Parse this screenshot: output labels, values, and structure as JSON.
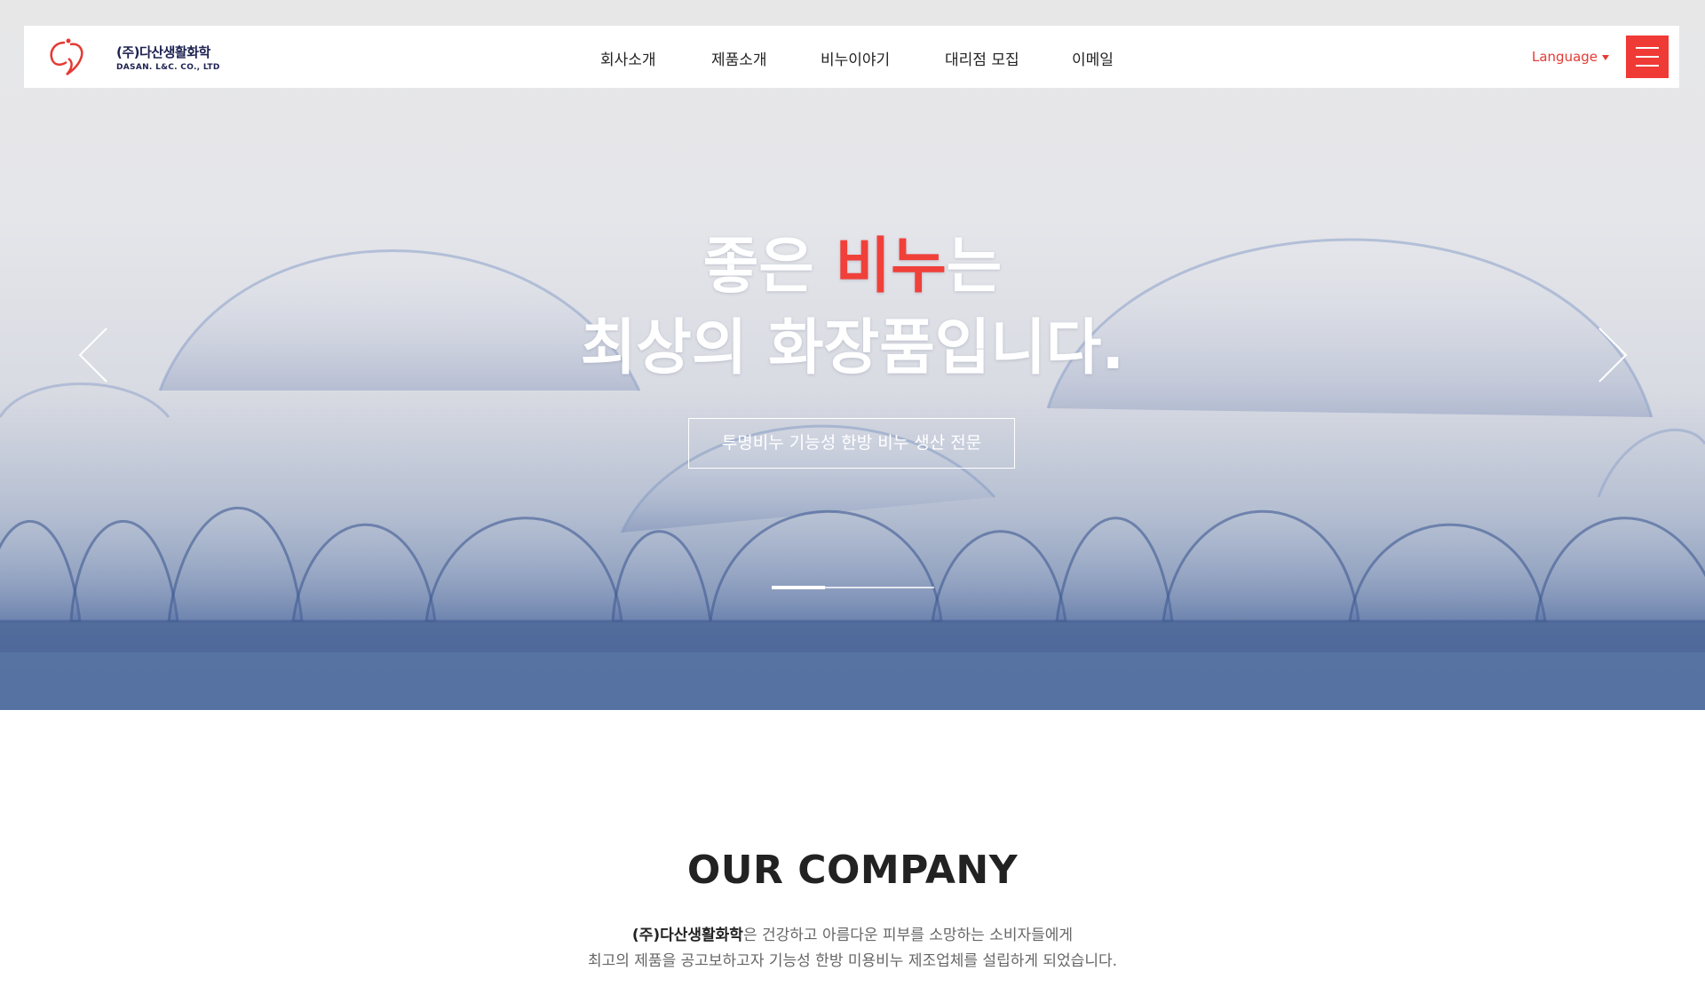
{
  "brand": {
    "name_ko": "(주)다산생활화학",
    "name_en": "DASAN. L&C. CO., LTD"
  },
  "nav": {
    "items": [
      {
        "label": "회사소개"
      },
      {
        "label": "제품소개"
      },
      {
        "label": "비누이야기"
      },
      {
        "label": "대리점 모집"
      },
      {
        "label": "이메일"
      }
    ],
    "language_label": "Language",
    "menu_icon": "hamburger-icon"
  },
  "hero": {
    "headline_line1_pre": "좋은 ",
    "headline_line1_accent": "비누",
    "headline_line1_post": "는",
    "headline_line2": "최상의 화장품입니다.",
    "tagline": "투명비누 기능성 한방 비누 생산 전문",
    "prev_icon": "chevron-left-icon",
    "next_icon": "chevron-right-icon",
    "slide_progress": 0.33
  },
  "company": {
    "title": "OUR COMPANY",
    "line1_brand": "(주)다산생활화학",
    "line1_rest": "은 건강하고 아름다운 피부를 소망하는 소비자들에게",
    "line2": "최고의 제품을 공고보하고자 기능성 한방 미용비누 제조업체를 설립하게 되었습니다."
  },
  "colors": {
    "accent": "#ef3a36",
    "brand_navy": "#1d2151"
  }
}
